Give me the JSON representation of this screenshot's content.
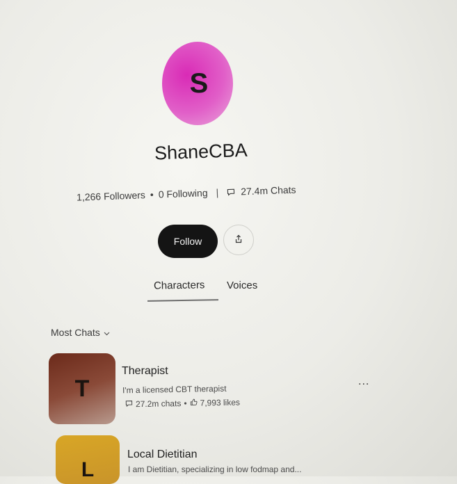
{
  "profile": {
    "avatar_letter": "S",
    "username": "ShaneCBA",
    "followers": "1,266 Followers",
    "following": "0 Following",
    "chats": "27.4m Chats",
    "follow_label": "Follow"
  },
  "tabs": [
    {
      "label": "Characters",
      "active": true
    },
    {
      "label": "Voices",
      "active": false
    }
  ],
  "sort": {
    "label": "Most Chats"
  },
  "characters": [
    {
      "initial": "T",
      "name": "Therapist",
      "description": "I'm a licensed CBT therapist",
      "chats": "27.2m chats",
      "likes": "7,993 likes",
      "more": "..."
    },
    {
      "initial": "L",
      "name": "Local Dietitian",
      "description": "I am Dietitian, specializing in low fodmap and..."
    }
  ],
  "colors": {
    "avatar": "#d92bb6",
    "follow_button": "#141414",
    "thumb_therapist": "#6b2a1a",
    "thumb_dietitian": "#d8a626"
  },
  "icons": {
    "chats": "chat-bubble-icon",
    "share": "share-icon",
    "likes": "thumbs-up-icon",
    "sort": "chevron-down-icon"
  }
}
